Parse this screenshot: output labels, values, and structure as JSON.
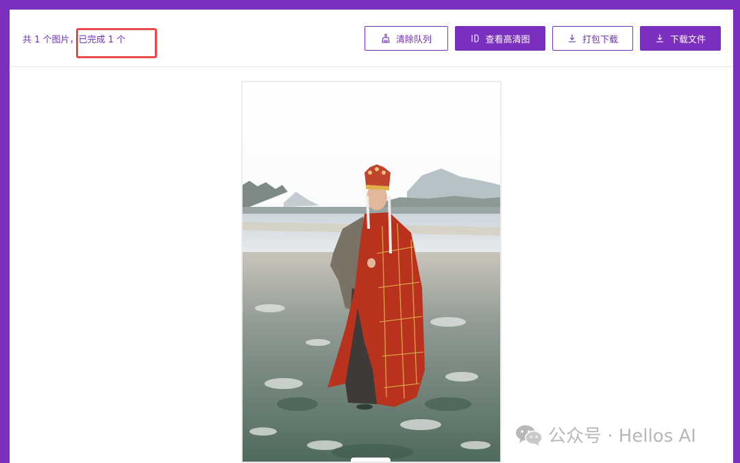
{
  "toolbar": {
    "status_total": "共 1 个图片，",
    "status_done": "已完成 1 个",
    "buttons": {
      "clear_queue": {
        "label": "清除队列",
        "icon": "broom-icon"
      },
      "view_hd": {
        "label": "查看高清图",
        "icon": "compare-icon"
      },
      "pack_download": {
        "label": "打包下载",
        "icon": "download-icon"
      },
      "download_file": {
        "label": "下载文件",
        "icon": "download-icon"
      }
    }
  },
  "watermark": {
    "text": "公众号 · Hellos AI",
    "icon": "wechat-icon"
  },
  "colors": {
    "frame": "#7b2fbe",
    "accent_text": "#6d2eb8",
    "highlight": "#ec4848"
  }
}
